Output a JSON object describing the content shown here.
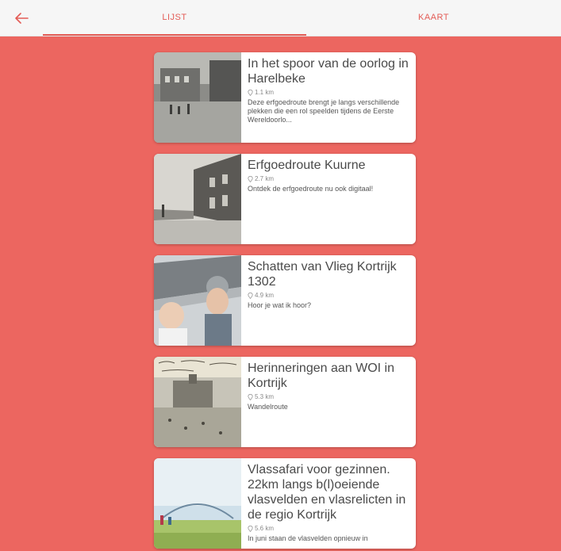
{
  "nav": {
    "back_icon": "arrow-left-icon",
    "tabs": [
      {
        "label": "LIJST",
        "active": true
      },
      {
        "label": "KAART",
        "active": false
      }
    ],
    "accent_color": "#e35c56"
  },
  "background_color": "#ec6660",
  "routes": [
    {
      "title": "In het spoor van de oorlog in Harelbeke",
      "distance": "1.1 km",
      "description": "Deze erfgoedroute brengt je langs verschillende plekken die een rol speelden tijdens de Eerste Wereldoorlo..."
    },
    {
      "title": "Erfgoedroute Kuurne",
      "distance": "2.7 km",
      "description": "Ontdek de erfgoedroute nu ook digitaal!"
    },
    {
      "title": "Schatten van Vlieg Kortrijk 1302",
      "distance": "4.9 km",
      "description": "Hoor je wat ik hoor?"
    },
    {
      "title": "Herinneringen aan WOI in Kortrijk",
      "distance": "5.3 km",
      "description": "Wandelroute"
    },
    {
      "title": "Vlassafari voor gezinnen. 22km langs b(l)oeiende vlasvelden en vlasrelicten in de regio Kortrijk",
      "distance": "5.6 km",
      "description": "In juni staan de vlasvelden opnieuw in"
    }
  ]
}
